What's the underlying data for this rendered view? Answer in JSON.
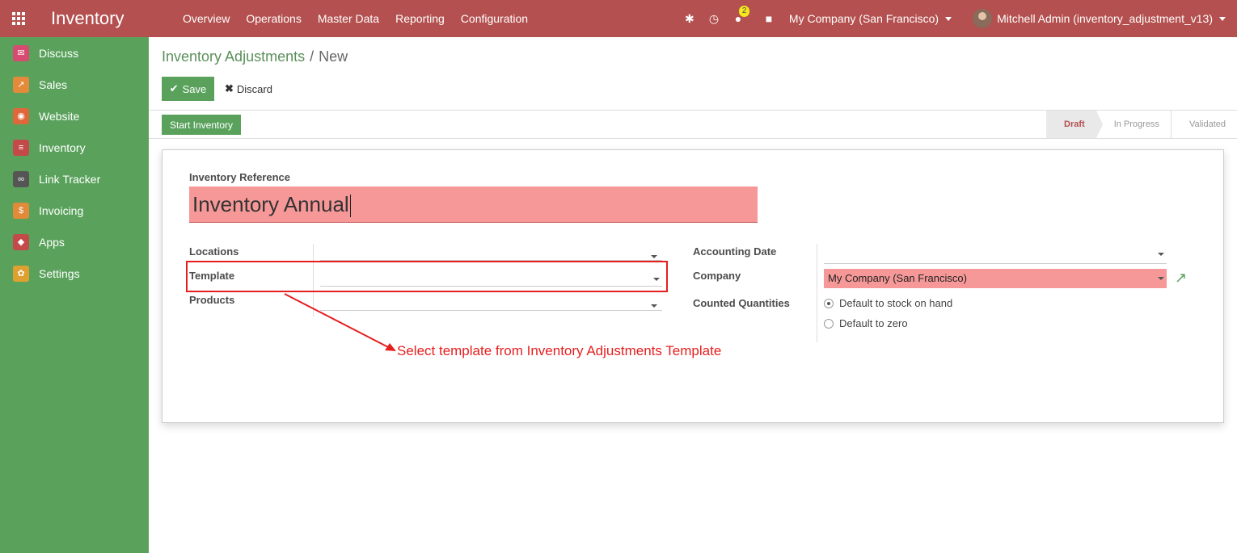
{
  "topbar": {
    "brand": "Inventory",
    "menu": [
      "Overview",
      "Operations",
      "Master Data",
      "Reporting",
      "Configuration"
    ],
    "chat_badge": "2",
    "company": "My Company (San Francisco)",
    "user": "Mitchell Admin (inventory_adjustment_v13)"
  },
  "sidebar": {
    "items": [
      {
        "label": "Discuss",
        "icon": "discuss-icon",
        "color": "#d64b70"
      },
      {
        "label": "Sales",
        "icon": "sales-icon",
        "color": "#e58a3a"
      },
      {
        "label": "Website",
        "icon": "website-icon",
        "color": "#e0673a"
      },
      {
        "label": "Inventory",
        "icon": "inventory-icon",
        "color": "#c44a4a"
      },
      {
        "label": "Link Tracker",
        "icon": "link-tracker-icon",
        "color": "#555555"
      },
      {
        "label": "Invoicing",
        "icon": "invoicing-icon",
        "color": "#e08a3a"
      },
      {
        "label": "Apps",
        "icon": "apps-icon",
        "color": "#c44a4a"
      },
      {
        "label": "Settings",
        "icon": "settings-icon",
        "color": "#e0a030"
      }
    ]
  },
  "breadcrumb": {
    "parent": "Inventory Adjustments",
    "separator": "/",
    "current": "New"
  },
  "buttons": {
    "save": "Save",
    "discard": "Discard",
    "start": "Start Inventory"
  },
  "stages": [
    "Draft",
    "In Progress",
    "Validated"
  ],
  "active_stage": "Draft",
  "form": {
    "reference_label": "Inventory Reference",
    "reference_value": "Inventory Annual",
    "locations_label": "Locations",
    "template_label": "Template",
    "products_label": "Products",
    "accounting_date_label": "Accounting Date",
    "company_label": "Company",
    "company_value": "My Company (San Francisco)",
    "counted_label": "Counted Quantities",
    "counted_options": [
      "Default to stock on hand",
      "Default to zero"
    ],
    "counted_selected": "Default to stock on hand"
  },
  "annotation": {
    "text": "Select template from Inventory Adjustments Template",
    "color": "#e61e1e"
  },
  "colors": {
    "topbar": "#b4504f",
    "sidebar": "#5aa25c",
    "required_field": "#f79898"
  }
}
